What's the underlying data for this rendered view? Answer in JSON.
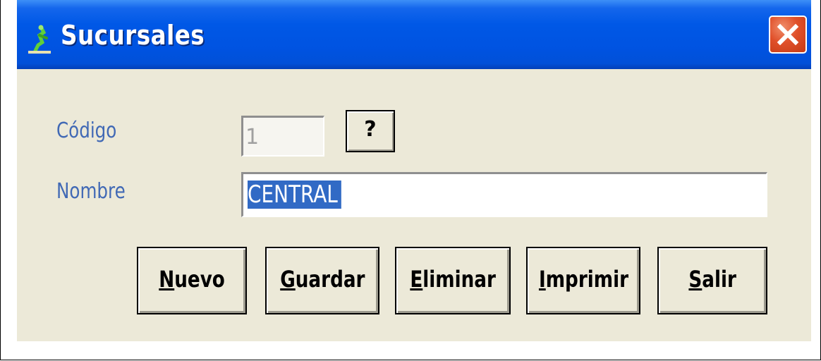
{
  "window": {
    "title": "Sucursales",
    "close_icon": "close-icon",
    "app_icon": "green-figure-icon",
    "colors": {
      "titlebar": "#0058e6",
      "client": "#ece9d8",
      "close": "#e0502a",
      "label": "#4169b5",
      "selection": "#316ac5"
    }
  },
  "form": {
    "codigo_label": "Código",
    "codigo_value": "1",
    "help_label": "?",
    "nombre_label": "Nombre",
    "nombre_value": "CENTRAL"
  },
  "buttons": {
    "nuevo": "Nuevo",
    "guardar": "Guardar",
    "eliminar": "Eliminar",
    "imprimir": "Imprimir",
    "salir": "Salir"
  }
}
